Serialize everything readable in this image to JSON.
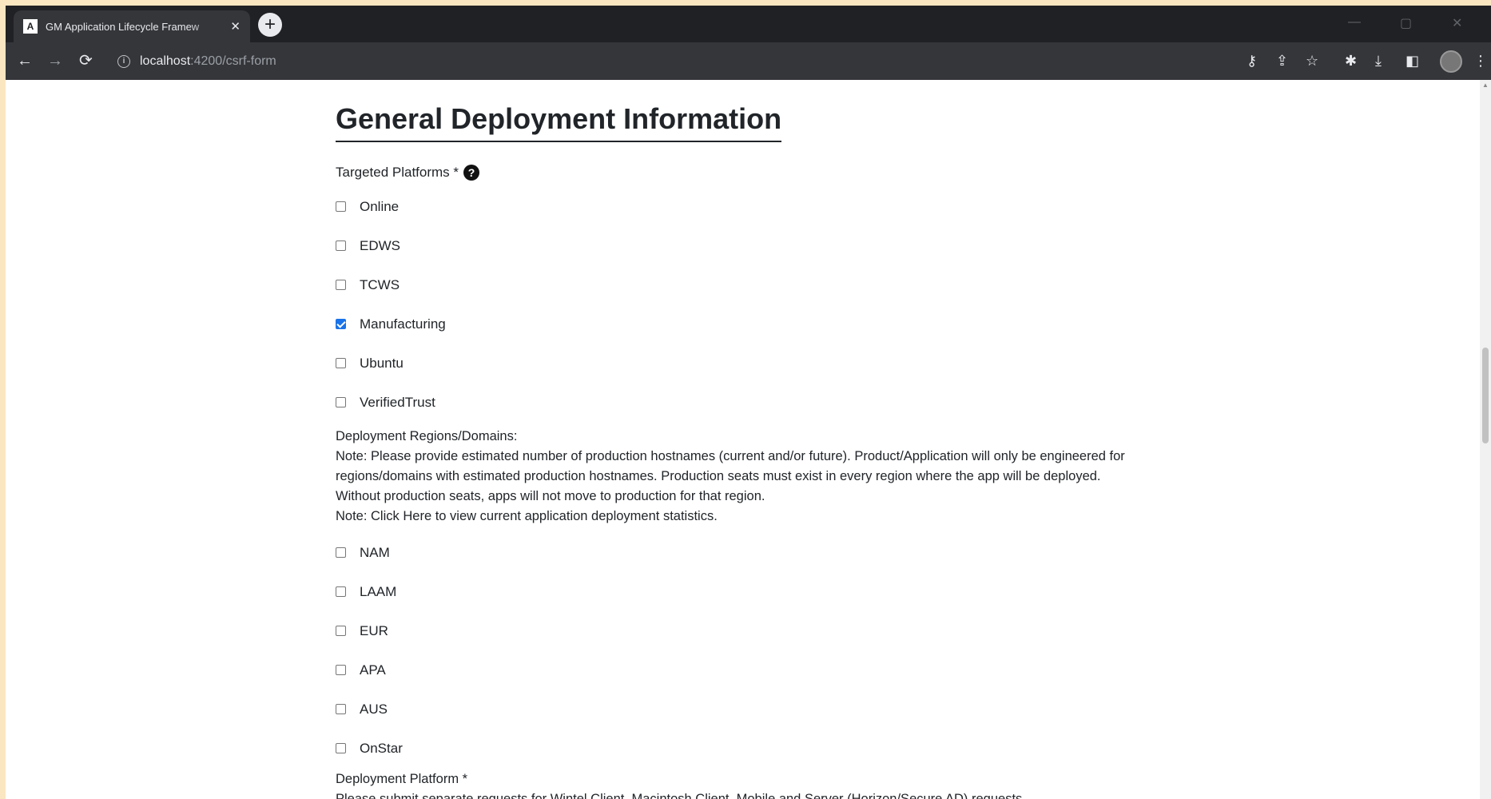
{
  "browser": {
    "tab_title": "GM Application Lifecycle Framew",
    "tab_favicon": "A",
    "new_tab": "+",
    "url_host": "localhost",
    "url_path": ":4200/csrf-form"
  },
  "icons": {
    "back": "←",
    "forward": "→",
    "reload": "⟳",
    "info": "i",
    "key": "⚷",
    "share": "⇪",
    "star": "☆",
    "extensions": "✱",
    "download": "⤓",
    "sidepanel": "◧",
    "menu": "⋮",
    "minimize": "—",
    "maximize": "▢",
    "close_window": "✕",
    "close_tab": "✕",
    "help": "?"
  },
  "section": {
    "title": "General Deployment Information"
  },
  "targeted_platforms": {
    "label": "Targeted Platforms *",
    "options": [
      {
        "label": "Online",
        "checked": false
      },
      {
        "label": "EDWS",
        "checked": false
      },
      {
        "label": "TCWS",
        "checked": false
      },
      {
        "label": "Manufacturing",
        "checked": true
      },
      {
        "label": "Ubuntu",
        "checked": false
      },
      {
        "label": "VerifiedTrust",
        "checked": false
      }
    ]
  },
  "deployment_regions": {
    "label": "Deployment Regions/Domains:",
    "note1": "Note: Please provide estimated number of production hostnames (current and/or future). Product/Application will only be engineered for regions/domains with estimated production hostnames. Production seats must exist in every region where the app will be deployed. Without production seats, apps will not move to production for that region.",
    "note2": "Note: Click Here to view current application deployment statistics.",
    "options": [
      {
        "label": "NAM",
        "checked": false
      },
      {
        "label": "LAAM",
        "checked": false
      },
      {
        "label": "EUR",
        "checked": false
      },
      {
        "label": "APA",
        "checked": false
      },
      {
        "label": "AUS",
        "checked": false
      },
      {
        "label": "OnStar",
        "checked": false
      }
    ]
  },
  "deployment_platform": {
    "label": "Deployment Platform *",
    "note": "Please submit separate requests for Wintel Client, Macintosh Client, Mobile and Server (Horizon/Secure AD) requests."
  },
  "colors": {
    "accent": "#1a73e8",
    "browser_dark": "#202124",
    "toolbar": "#35363a",
    "text": "#212529"
  }
}
